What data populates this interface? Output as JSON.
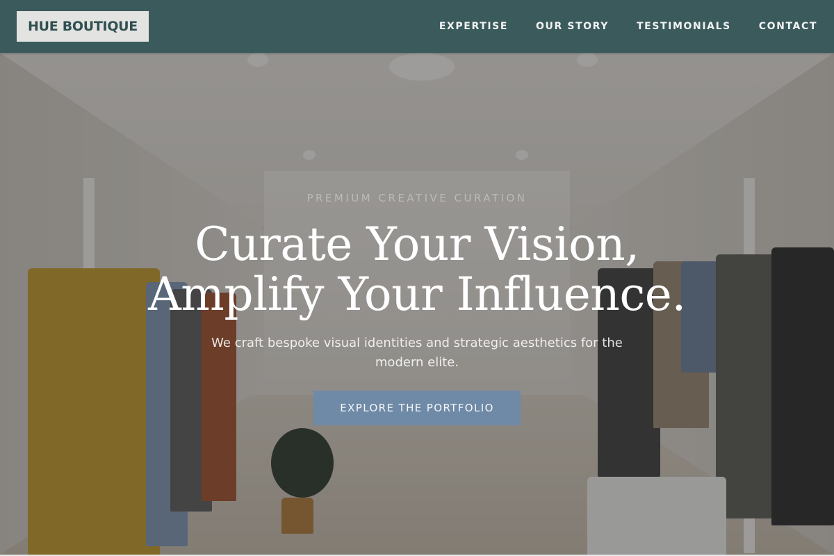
{
  "header": {
    "logo": "HUE BOUTIQUE",
    "nav": [
      {
        "label": "EXPERTISE"
      },
      {
        "label": "OUR STORY"
      },
      {
        "label": "TESTIMONIALS"
      },
      {
        "label": "CONTACT"
      }
    ]
  },
  "hero": {
    "eyebrow": "PREMIUM CREATIVE CURATION",
    "headline_line1": "Curate Your Vision,",
    "headline_line2": "Amplify Your Influence.",
    "subline": "We craft bespoke visual identities and strategic aesthetics for the modern elite.",
    "cta_label": "EXPLORE THE PORTFOLIO",
    "background_image": "boutique-interior-photo"
  },
  "colors": {
    "header_bg": "#3a5a5c",
    "logo_bg": "#e3e3e1",
    "logo_text": "#2f4f51",
    "cta_bg": "#6f8aa6"
  }
}
